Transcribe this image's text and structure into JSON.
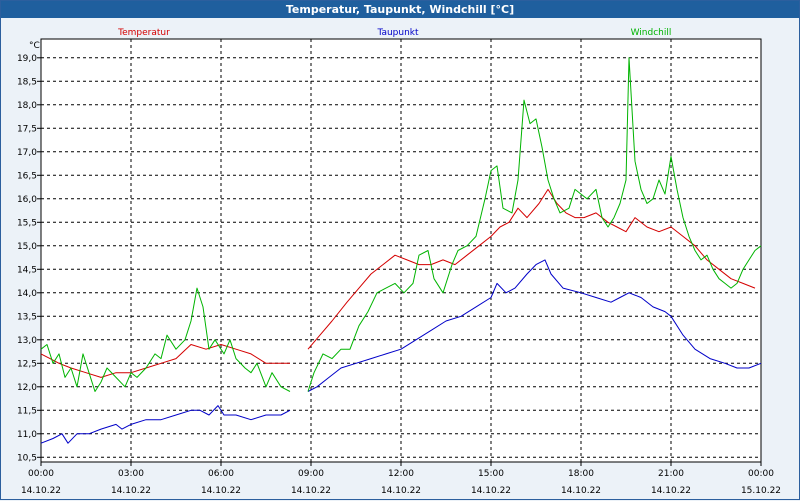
{
  "window": {
    "title": "Temperatur, Taupunkt, Windchill [°C]"
  },
  "colors": {
    "Temperatur": "#d40000",
    "Taupunkt": "#0000c8",
    "Windchill": "#00b400",
    "grid": "#000000",
    "background": "#ffffff",
    "titlebar": "#1f5f9e"
  },
  "chart_data": {
    "type": "line",
    "title": "Temperatur, Taupunkt, Windchill [°C]",
    "ylabel": "°C",
    "xlabel": "",
    "ylim": [
      10.4,
      19.4
    ],
    "xlim": [
      0,
      24
    ],
    "grid": true,
    "legend": "top",
    "yticks": [
      "10,5",
      "11,0",
      "11,5",
      "12,0",
      "12,5",
      "13,0",
      "13,5",
      "14,0",
      "14,5",
      "15,0",
      "15,5",
      "16,0",
      "16,5",
      "17,0",
      "17,5",
      "18,0",
      "18,5",
      "19,0"
    ],
    "xticks": [
      {
        "time": "00:00",
        "date": "14.10.22"
      },
      {
        "time": "03:00",
        "date": "14.10.22"
      },
      {
        "time": "06:00",
        "date": "14.10.22"
      },
      {
        "time": "09:00",
        "date": "14.10.22"
      },
      {
        "time": "12:00",
        "date": "14.10.22"
      },
      {
        "time": "15:00",
        "date": "14.10.22"
      },
      {
        "time": "18:00",
        "date": "14.10.22"
      },
      {
        "time": "21:00",
        "date": "14.10.22"
      },
      {
        "time": "00:00",
        "date": "15.10.22"
      }
    ],
    "series": [
      {
        "name": "Temperatur",
        "segments": [
          [
            [
              0,
              12.7
            ],
            [
              0.3,
              12.6
            ],
            [
              0.6,
              12.5
            ],
            [
              1.0,
              12.4
            ],
            [
              1.5,
              12.3
            ],
            [
              2.0,
              12.2
            ],
            [
              2.5,
              12.3
            ],
            [
              3.0,
              12.3
            ],
            [
              3.5,
              12.4
            ],
            [
              4.0,
              12.5
            ],
            [
              4.5,
              12.6
            ],
            [
              5.0,
              12.9
            ],
            [
              5.5,
              12.8
            ],
            [
              6.0,
              12.9
            ],
            [
              6.5,
              12.8
            ],
            [
              7.0,
              12.7
            ],
            [
              7.5,
              12.5
            ],
            [
              8.0,
              12.5
            ],
            [
              8.3,
              12.5
            ]
          ],
          [
            [
              8.9,
              12.8
            ],
            [
              9.3,
              13.1
            ],
            [
              9.7,
              13.4
            ],
            [
              10.2,
              13.8
            ],
            [
              10.6,
              14.1
            ],
            [
              11.0,
              14.4
            ],
            [
              11.4,
              14.6
            ],
            [
              11.8,
              14.8
            ],
            [
              12.2,
              14.7
            ],
            [
              12.6,
              14.6
            ],
            [
              13.0,
              14.6
            ],
            [
              13.4,
              14.7
            ],
            [
              13.8,
              14.6
            ],
            [
              14.2,
              14.8
            ],
            [
              14.6,
              15.0
            ],
            [
              15.0,
              15.2
            ],
            [
              15.3,
              15.4
            ],
            [
              15.6,
              15.5
            ],
            [
              15.9,
              15.8
            ],
            [
              16.2,
              15.6
            ],
            [
              16.6,
              15.9
            ],
            [
              16.9,
              16.2
            ],
            [
              17.2,
              15.9
            ],
            [
              17.5,
              15.7
            ],
            [
              17.8,
              15.6
            ],
            [
              18.1,
              15.6
            ],
            [
              18.5,
              15.7
            ],
            [
              18.9,
              15.5
            ],
            [
              19.2,
              15.4
            ],
            [
              19.5,
              15.3
            ],
            [
              19.8,
              15.6
            ],
            [
              20.2,
              15.4
            ],
            [
              20.6,
              15.3
            ],
            [
              21.0,
              15.4
            ],
            [
              21.4,
              15.2
            ],
            [
              21.8,
              15.0
            ],
            [
              22.2,
              14.7
            ],
            [
              22.6,
              14.5
            ],
            [
              23.0,
              14.3
            ],
            [
              23.4,
              14.2
            ],
            [
              23.8,
              14.1
            ]
          ]
        ]
      },
      {
        "name": "Taupunkt",
        "segments": [
          [
            [
              0,
              10.8
            ],
            [
              0.4,
              10.9
            ],
            [
              0.7,
              11.0
            ],
            [
              0.9,
              10.8
            ],
            [
              1.2,
              11.0
            ],
            [
              1.6,
              11.0
            ],
            [
              2.0,
              11.1
            ],
            [
              2.5,
              11.2
            ],
            [
              2.7,
              11.1
            ],
            [
              3.0,
              11.2
            ],
            [
              3.5,
              11.3
            ],
            [
              4.0,
              11.3
            ],
            [
              4.5,
              11.4
            ],
            [
              5.0,
              11.5
            ],
            [
              5.3,
              11.5
            ],
            [
              5.6,
              11.4
            ],
            [
              5.9,
              11.6
            ],
            [
              6.1,
              11.4
            ],
            [
              6.5,
              11.4
            ],
            [
              7.0,
              11.3
            ],
            [
              7.5,
              11.4
            ],
            [
              8.0,
              11.4
            ],
            [
              8.3,
              11.5
            ]
          ],
          [
            [
              8.9,
              11.9
            ],
            [
              9.2,
              12.0
            ],
            [
              9.6,
              12.2
            ],
            [
              10.0,
              12.4
            ],
            [
              10.5,
              12.5
            ],
            [
              11.0,
              12.6
            ],
            [
              11.5,
              12.7
            ],
            [
              12.0,
              12.8
            ],
            [
              12.5,
              13.0
            ],
            [
              13.0,
              13.2
            ],
            [
              13.5,
              13.4
            ],
            [
              14.0,
              13.5
            ],
            [
              14.5,
              13.7
            ],
            [
              15.0,
              13.9
            ],
            [
              15.2,
              14.2
            ],
            [
              15.5,
              14.0
            ],
            [
              15.8,
              14.1
            ],
            [
              16.2,
              14.4
            ],
            [
              16.5,
              14.6
            ],
            [
              16.8,
              14.7
            ],
            [
              17.0,
              14.4
            ],
            [
              17.4,
              14.1
            ],
            [
              18.0,
              14.0
            ],
            [
              18.5,
              13.9
            ],
            [
              19.0,
              13.8
            ],
            [
              19.3,
              13.9
            ],
            [
              19.6,
              14.0
            ],
            [
              20.0,
              13.9
            ],
            [
              20.4,
              13.7
            ],
            [
              20.8,
              13.6
            ],
            [
              21.0,
              13.5
            ],
            [
              21.4,
              13.1
            ],
            [
              21.8,
              12.8
            ],
            [
              22.3,
              12.6
            ],
            [
              22.8,
              12.5
            ],
            [
              23.2,
              12.4
            ],
            [
              23.6,
              12.4
            ],
            [
              24.0,
              12.5
            ]
          ]
        ]
      },
      {
        "name": "Windchill",
        "segments": [
          [
            [
              0,
              12.8
            ],
            [
              0.2,
              12.9
            ],
            [
              0.4,
              12.5
            ],
            [
              0.6,
              12.7
            ],
            [
              0.8,
              12.2
            ],
            [
              1.0,
              12.4
            ],
            [
              1.2,
              12.0
            ],
            [
              1.4,
              12.7
            ],
            [
              1.6,
              12.3
            ],
            [
              1.8,
              11.9
            ],
            [
              2.0,
              12.1
            ],
            [
              2.2,
              12.4
            ],
            [
              2.5,
              12.2
            ],
            [
              2.8,
              12.0
            ],
            [
              3.0,
              12.3
            ],
            [
              3.2,
              12.2
            ],
            [
              3.5,
              12.4
            ],
            [
              3.8,
              12.7
            ],
            [
              4.0,
              12.6
            ],
            [
              4.2,
              13.1
            ],
            [
              4.5,
              12.8
            ],
            [
              4.8,
              13.0
            ],
            [
              5.0,
              13.4
            ],
            [
              5.2,
              14.1
            ],
            [
              5.4,
              13.7
            ],
            [
              5.6,
              12.8
            ],
            [
              5.8,
              13.0
            ],
            [
              6.1,
              12.7
            ],
            [
              6.3,
              13.0
            ],
            [
              6.5,
              12.6
            ],
            [
              6.8,
              12.4
            ],
            [
              7.0,
              12.3
            ],
            [
              7.2,
              12.5
            ],
            [
              7.5,
              12.0
            ],
            [
              7.7,
              12.3
            ],
            [
              8.0,
              12.0
            ],
            [
              8.3,
              11.9
            ]
          ],
          [
            [
              8.9,
              11.9
            ],
            [
              9.1,
              12.3
            ],
            [
              9.4,
              12.7
            ],
            [
              9.7,
              12.6
            ],
            [
              10.0,
              12.8
            ],
            [
              10.3,
              12.8
            ],
            [
              10.6,
              13.3
            ],
            [
              10.9,
              13.6
            ],
            [
              11.2,
              14.0
            ],
            [
              11.5,
              14.1
            ],
            [
              11.8,
              14.2
            ],
            [
              12.1,
              14.0
            ],
            [
              12.4,
              14.2
            ],
            [
              12.6,
              14.8
            ],
            [
              12.9,
              14.9
            ],
            [
              13.1,
              14.3
            ],
            [
              13.4,
              14.0
            ],
            [
              13.7,
              14.6
            ],
            [
              13.9,
              14.9
            ],
            [
              14.2,
              15.0
            ],
            [
              14.5,
              15.2
            ],
            [
              14.8,
              16.0
            ],
            [
              15.0,
              16.6
            ],
            [
              15.2,
              16.7
            ],
            [
              15.4,
              15.8
            ],
            [
              15.7,
              15.7
            ],
            [
              15.9,
              16.4
            ],
            [
              16.1,
              18.1
            ],
            [
              16.3,
              17.6
            ],
            [
              16.5,
              17.7
            ],
            [
              16.7,
              17.1
            ],
            [
              16.9,
              16.4
            ],
            [
              17.1,
              16.0
            ],
            [
              17.3,
              15.7
            ],
            [
              17.6,
              15.8
            ],
            [
              17.8,
              16.2
            ],
            [
              18.0,
              16.1
            ],
            [
              18.2,
              16.0
            ],
            [
              18.5,
              16.2
            ],
            [
              18.7,
              15.6
            ],
            [
              18.9,
              15.4
            ],
            [
              19.1,
              15.6
            ],
            [
              19.3,
              15.9
            ],
            [
              19.5,
              16.4
            ],
            [
              19.6,
              19.0
            ],
            [
              19.8,
              16.8
            ],
            [
              20.0,
              16.2
            ],
            [
              20.2,
              15.9
            ],
            [
              20.4,
              16.0
            ],
            [
              20.6,
              16.4
            ],
            [
              20.8,
              16.1
            ],
            [
              21.0,
              16.9
            ],
            [
              21.2,
              16.2
            ],
            [
              21.4,
              15.6
            ],
            [
              21.6,
              15.2
            ],
            [
              21.8,
              14.9
            ],
            [
              22.0,
              14.7
            ],
            [
              22.2,
              14.8
            ],
            [
              22.4,
              14.5
            ],
            [
              22.6,
              14.3
            ],
            [
              22.8,
              14.2
            ],
            [
              23.0,
              14.1
            ],
            [
              23.2,
              14.2
            ],
            [
              23.4,
              14.5
            ],
            [
              23.6,
              14.7
            ],
            [
              23.8,
              14.9
            ],
            [
              24.0,
              15.0
            ]
          ]
        ]
      }
    ]
  }
}
